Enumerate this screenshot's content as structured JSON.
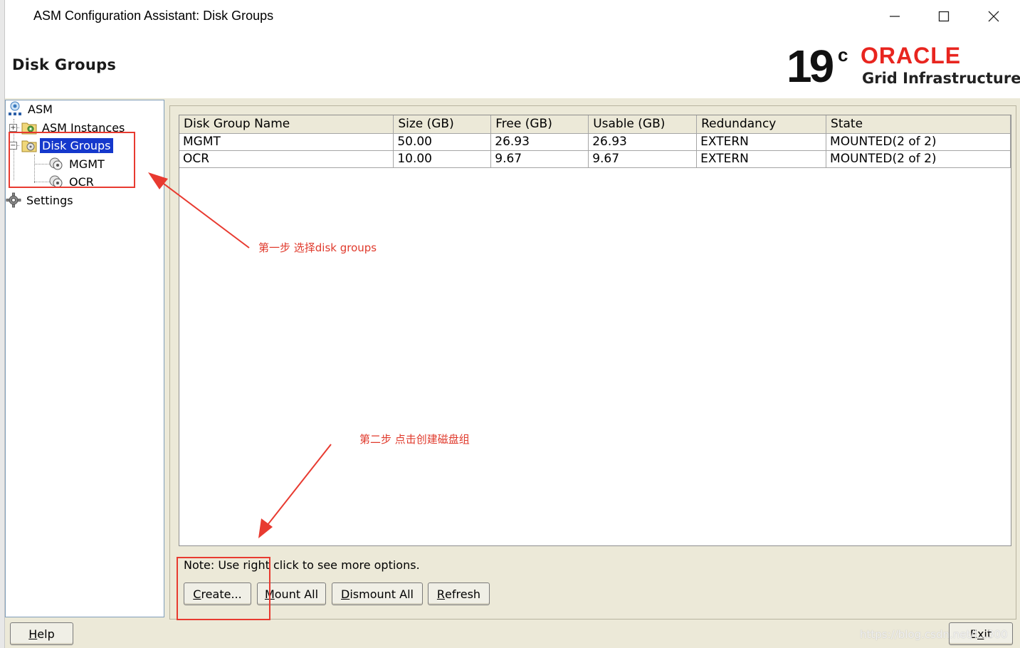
{
  "window": {
    "title": "ASM Configuration Assistant: Disk Groups",
    "minimize_glyph": "—",
    "maximize_glyph": "☐",
    "close_glyph": "✕"
  },
  "header": {
    "page_title": "Disk Groups",
    "logo": {
      "version": "19",
      "superscript": "c",
      "brand": "ORACLE",
      "product": "Grid Infrastructure",
      "brand_color": "#e8251f"
    }
  },
  "tree": {
    "root": "ASM",
    "items": [
      {
        "label": "ASM Instances",
        "icon": "folder-gear-icon",
        "expander": "+"
      },
      {
        "label": "Disk Groups",
        "icon": "folder-disk-icon",
        "expander": "−",
        "selected": true
      },
      {
        "label": "MGMT",
        "icon": "disk-icon"
      },
      {
        "label": "OCR",
        "icon": "disk-icon"
      },
      {
        "label": "Settings",
        "icon": "gear-icon"
      }
    ]
  },
  "table": {
    "columns": [
      "Disk Group Name",
      "Size (GB)",
      "Free (GB)",
      "Usable (GB)",
      "Redundancy",
      "State"
    ],
    "rows": [
      [
        "MGMT",
        "50.00",
        "26.93",
        "26.93",
        "EXTERN",
        "MOUNTED(2 of 2)"
      ],
      [
        "OCR",
        "10.00",
        "9.67",
        "9.67",
        "EXTERN",
        "MOUNTED(2 of 2)"
      ]
    ]
  },
  "note": "Note: Use right click to see more options.",
  "buttons": {
    "create_pre": "",
    "create_key": "C",
    "create_post": "reate...",
    "mount_pre": "",
    "mount_key": "M",
    "mount_post": "ount All",
    "dismount_pre": "",
    "dismount_key": "D",
    "dismount_post": "ismount All",
    "refresh_pre": "",
    "refresh_key": "R",
    "refresh_post": "efresh",
    "help_pre": "",
    "help_key": "H",
    "help_post": "elp",
    "exit_pre": "E",
    "exit_key": "x",
    "exit_post": "it"
  },
  "annotations": {
    "step1": "第一步 选择disk groups",
    "step2": "第二步 点击创建磁盘组",
    "color": "#e83a30"
  },
  "watermark": "https://blog.csdn.net/l...300"
}
